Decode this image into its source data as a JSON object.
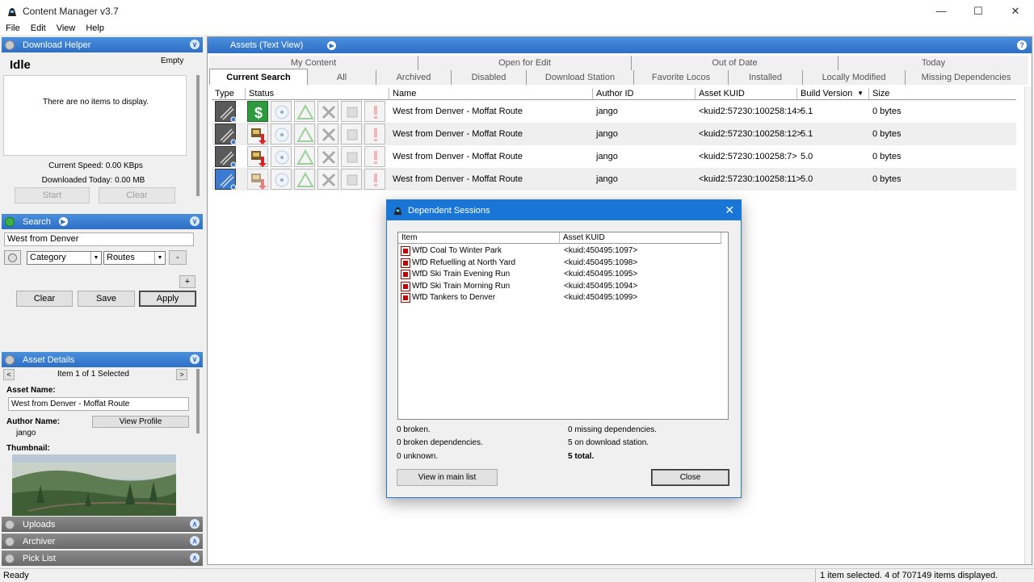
{
  "window": {
    "title": "Content Manager v3.7"
  },
  "menu": [
    "File",
    "Edit",
    "View",
    "Help"
  ],
  "download_helper": {
    "header": "Download Helper",
    "state": "Idle",
    "queue_label": "Empty",
    "empty_text": "There are no items to display.",
    "speed": "Current Speed: 0.00 KBps",
    "today": "Downloaded Today: 0.00 MB",
    "start_label": "Start",
    "clear_label": "Clear"
  },
  "search": {
    "header": "Search",
    "query": "West from Denver",
    "filter_field": "Category",
    "filter_value": "Routes",
    "remove_label": "-",
    "add_label": "+",
    "clear_label": "Clear",
    "save_label": "Save",
    "apply_label": "Apply"
  },
  "asset_details": {
    "header": "Asset Details",
    "prev": "<",
    "next": ">",
    "position": "Item 1 of 1 Selected",
    "name_label": "Asset Name:",
    "name_value": "West from Denver - Moffat Route",
    "author_label": "Author Name:",
    "author_value": "jango",
    "view_profile_label": "View Profile",
    "thumbnail_label": "Thumbnail:"
  },
  "collapsed_panels": [
    "Uploads",
    "Archiver",
    "Pick List"
  ],
  "main": {
    "header": "Assets (Text View)",
    "help": "?",
    "tabs_row1": [
      "My Content",
      "Open for Edit",
      "Out of Date",
      "Today"
    ],
    "tabs_row2": [
      "Current Search",
      "All",
      "Archived",
      "Disabled",
      "Download Station",
      "Favorite Locos",
      "Installed",
      "Locally Modified",
      "Missing Dependencies"
    ],
    "columns": [
      "Type",
      "Status",
      "Name",
      "Author ID",
      "Asset KUID",
      "Build Version",
      "Size"
    ],
    "rows": [
      {
        "name": "West from Denver - Moffat Route",
        "author": "jango",
        "kuid": "<kuid2:57230:100258:14>",
        "build": "5.1",
        "size": "0 bytes",
        "status": "dollar"
      },
      {
        "name": "West from Denver - Moffat Route",
        "author": "jango",
        "kuid": "<kuid2:57230:100258:12>",
        "build": "5.1",
        "size": "0 bytes",
        "status": "download"
      },
      {
        "name": "West from Denver - Moffat Route",
        "author": "jango",
        "kuid": "<kuid2:57230:100258:7>",
        "build": "5.0",
        "size": "0 bytes",
        "status": "download"
      },
      {
        "name": "West from Denver - Moffat Route",
        "author": "jango",
        "kuid": "<kuid2:57230:100258:11>",
        "build": "5.0",
        "size": "0 bytes",
        "status": "download-faded"
      }
    ]
  },
  "dialog": {
    "title": "Dependent Sessions",
    "col_item": "Item",
    "col_kuid": "Asset KUID",
    "items": [
      {
        "item": "WfD Coal To Winter Park",
        "kuid": "<kuid:450495:1097>"
      },
      {
        "item": "WfD Refuelling at North Yard",
        "kuid": "<kuid:450495:1098>"
      },
      {
        "item": "WfD Ski Train Evening Run",
        "kuid": "<kuid:450495:1095>"
      },
      {
        "item": "WfD Ski Train Morning Run",
        "kuid": "<kuid:450495:1094>"
      },
      {
        "item": "WfD Tankers to Denver",
        "kuid": "<kuid:450495:1099>"
      }
    ],
    "broken": "0 broken.",
    "broken_deps": "0 broken dependencies.",
    "unknown": "0 unknown.",
    "missing": "0 missing dependencies.",
    "on_station": "5 on download station.",
    "total": "5 total.",
    "view_btn": "View in main list",
    "close_btn": "Close"
  },
  "status": {
    "left": "Ready",
    "right": "1 item selected. 4 of 707149 items displayed."
  }
}
